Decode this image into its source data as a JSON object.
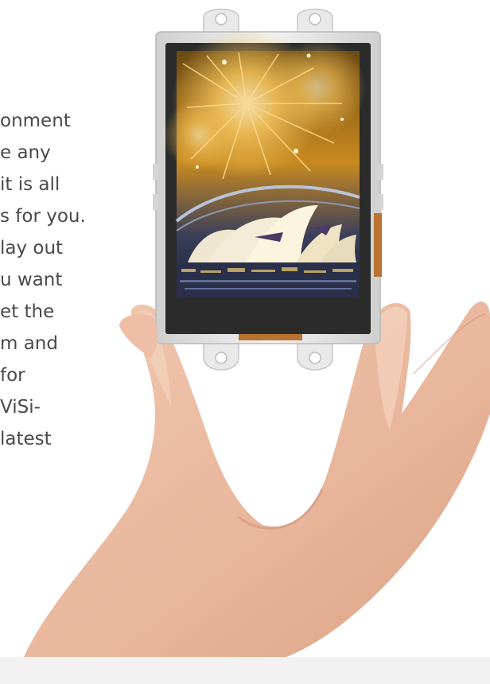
{
  "article": {
    "text_lines": [
      "onment",
      "e any",
      " it is all",
      "s for you.",
      "lay out",
      "u want",
      "et the",
      "m and",
      " for",
      " ViSi-",
      " latest"
    ]
  },
  "product_image": {
    "icon": "display-module-in-hand",
    "screen_scene": "fireworks-over-opera-house"
  },
  "colors": {
    "text": "#4a4a4a",
    "bezel": "#2b2b2b",
    "frame": "#dcdcdc",
    "skin": "#e8b9a0"
  }
}
